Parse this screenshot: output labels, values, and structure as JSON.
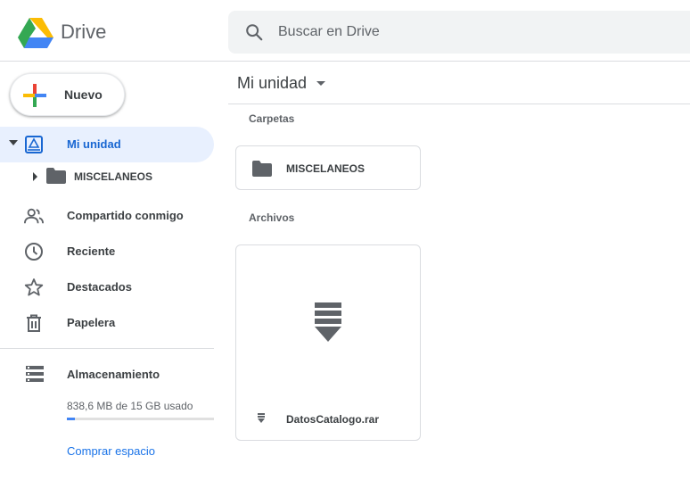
{
  "header": {
    "brand": "Drive",
    "search_placeholder": "Buscar en Drive"
  },
  "sidebar": {
    "new_label": "Nuevo",
    "items": [
      {
        "label": "Mi unidad",
        "icon": "my-drive-icon",
        "active": true
      },
      {
        "label": "Compartido conmigo",
        "icon": "people-icon"
      },
      {
        "label": "Reciente",
        "icon": "clock-icon"
      },
      {
        "label": "Destacados",
        "icon": "star-icon"
      },
      {
        "label": "Papelera",
        "icon": "trash-icon"
      }
    ],
    "subfolder": {
      "label": "MISCELANEOS",
      "icon": "folder-icon"
    },
    "storage": {
      "label": "Almacenamiento",
      "usage_text": "838,6 MB de 15 GB usado",
      "usage_fraction": 0.055,
      "buy_label": "Comprar espacio"
    }
  },
  "main": {
    "title": "Mi unidad",
    "folders_section": "Carpetas",
    "folders": [
      {
        "name": "MISCELANEOS"
      }
    ],
    "files_section": "Archivos",
    "files": [
      {
        "name": "DatosCatalogo.rar",
        "icon": "archive-icon"
      }
    ]
  },
  "colors": {
    "accent": "#1967d2",
    "active_bg": "#e8f0fe",
    "link": "#1a73e8"
  }
}
